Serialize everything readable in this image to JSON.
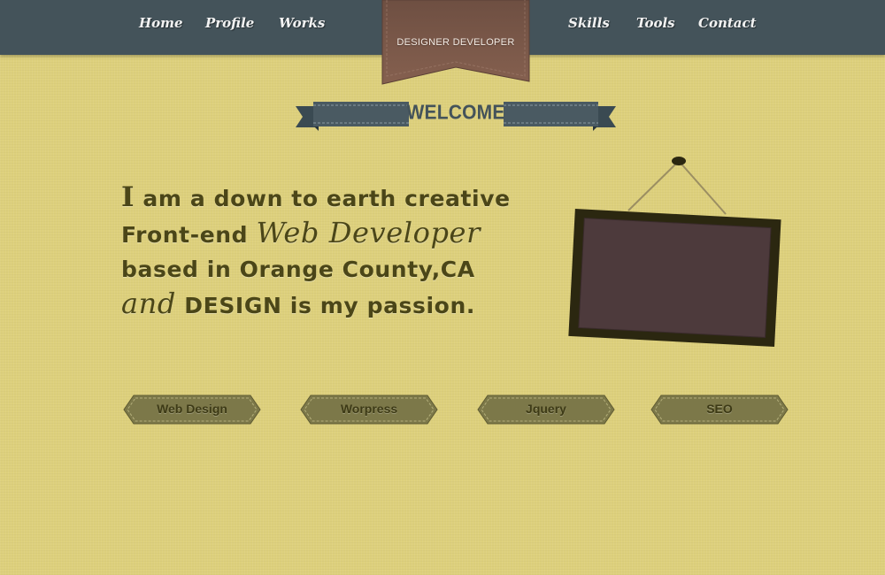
{
  "nav": {
    "items": [
      {
        "label": "Home"
      },
      {
        "label": "Profile"
      },
      {
        "label": "Works"
      },
      {
        "label": "Skills"
      },
      {
        "label": "Tools"
      },
      {
        "label": "Contact"
      }
    ]
  },
  "header": {
    "tagline": "DESIGNER DEVELOPER"
  },
  "welcome": {
    "title": "WELCOME"
  },
  "intro": {
    "line1_cap": "I",
    "line1_rest": " am a down to earth creative",
    "line2_plain": "Front-end ",
    "line2_script": "Web Developer",
    "line3": "based in Orange County,CA",
    "line4_script": "and",
    "line4_rest": " DESIGN is my passion."
  },
  "skills": {
    "tags": [
      {
        "label": "Web Design"
      },
      {
        "label": "Worpress"
      },
      {
        "label": "Jquery"
      },
      {
        "label": "SEO"
      }
    ]
  },
  "colors": {
    "background": "#ddd07c",
    "nav_bar": "#44535a",
    "bookmark": "#7a5748",
    "intro_text": "#4b4618",
    "frame_border": "#2b2710",
    "frame_board": "#4d3a3c",
    "tag_fill": "#7c7849"
  },
  "icons": {
    "frame": "hanging-picture-frame",
    "bookmark": "ribbon-bookmark"
  }
}
